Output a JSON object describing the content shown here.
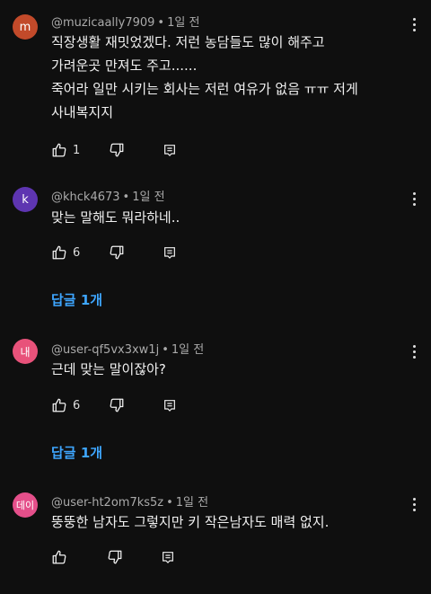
{
  "comments": [
    {
      "avatar_letter": "m",
      "avatar_color": "#c24a2a",
      "author": "@muzicaally7909",
      "time": "1일 전",
      "lines": [
        "직장생활 재밋었겠다. 저런 농담들도 많이 해주고",
        "가려운곳 만져도 주고......",
        "죽어라 일만 시키는 회사는 저런 여유가 없음 ㅠㅠ 저게",
        "사내복지지"
      ],
      "likes": "1"
    },
    {
      "avatar_letter": "k",
      "avatar_color": "#5e35b1",
      "author": "@khck4673",
      "time": "1일 전",
      "lines": [
        "맞는 말해도 뭐라하네.."
      ],
      "likes": "6",
      "replies_label": "답글 1개"
    },
    {
      "avatar_letter": "내",
      "avatar_color": "#e8527a",
      "author": "@user-qf5vx3xw1j",
      "time": "1일 전",
      "lines": [
        "근데 맞는 말이잖아?"
      ],
      "likes": "6",
      "replies_label": "답글 1개"
    },
    {
      "avatar_letter": "데이",
      "avatar_color": "#e44f8a",
      "author": "@user-ht2om7ks5z",
      "time": "1일 전",
      "lines": [
        "뚱뚱한 남자도 그렇지만 키 작은남자도 매력 없지."
      ],
      "likes": ""
    }
  ],
  "separator": "•",
  "icons": {
    "like": "thumb-up-icon",
    "dislike": "thumb-down-icon",
    "reply": "reply-comment-icon",
    "menu": "more-vert-icon"
  }
}
